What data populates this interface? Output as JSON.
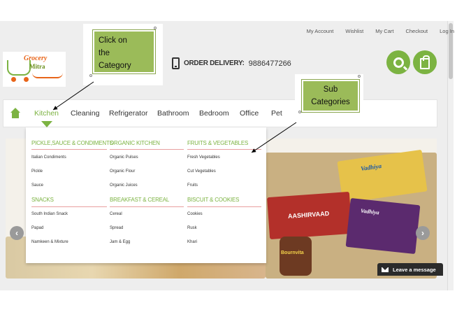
{
  "top_links": [
    "My Account",
    "Wishlist",
    "My Cart",
    "Checkout",
    "Log In"
  ],
  "logo": {
    "line1": "Grocery",
    "line2": "Mitra"
  },
  "order": {
    "label": "ORDER DELIVERY:",
    "number": "9886477266"
  },
  "nav": {
    "items": [
      "Kitchen",
      "Cleaning",
      "Refrigerator",
      "Bathroom",
      "Bedroom",
      "Office",
      "Pet"
    ],
    "active": "Kitchen"
  },
  "mega_menu": {
    "columns": [
      {
        "groups": [
          {
            "heading": "PICKLE,SAUCE & CONDIMENTS",
            "links": [
              "Italian Condiments",
              "Pickle",
              "Sauce"
            ]
          },
          {
            "heading": "SNACKS",
            "links": [
              "South Indian Snack",
              "Papad",
              "Namkeen & Mixture"
            ]
          }
        ]
      },
      {
        "groups": [
          {
            "heading": "ORGANIC KITCHEN",
            "links": [
              "Organic Pulses",
              "Organic Flour",
              "Organic Juices"
            ]
          },
          {
            "heading": "BREAKFAST & CEREAL",
            "links": [
              "Cereal",
              "Spread",
              "Jam & Egg"
            ]
          }
        ]
      },
      {
        "groups": [
          {
            "heading": "FRUITS & VEGETABLES",
            "links": [
              "Fresh Vegetables",
              "Cut Vegetables",
              "Fruits"
            ]
          },
          {
            "heading": "BISCUIT & COOKIES",
            "links": [
              "Cookies",
              "Rusk",
              "Khari"
            ]
          }
        ]
      }
    ]
  },
  "banner": {
    "brands": [
      "Vadhiya",
      "AASHIRVAAD",
      "Bournvita",
      "Vadhiya"
    ]
  },
  "callouts": {
    "category": [
      "Click on",
      "the",
      "Category"
    ],
    "sub": [
      "Sub",
      "Categories"
    ]
  },
  "chat": {
    "label": "Leave a message"
  },
  "colors": {
    "accent": "#7cb342",
    "callout": "#9bbb59",
    "rule": "#e8a0a0"
  }
}
